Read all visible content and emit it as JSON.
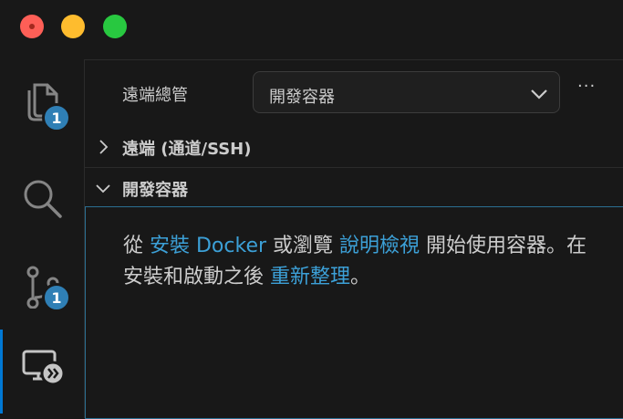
{
  "window": {
    "controls": [
      "close",
      "minimize",
      "maximize"
    ]
  },
  "activity_bar": {
    "items": [
      {
        "name": "explorer",
        "icon": "files-icon",
        "badge": "1"
      },
      {
        "name": "search",
        "icon": "search-icon",
        "badge": ""
      },
      {
        "name": "source-control",
        "icon": "source-control-icon",
        "badge": "1"
      },
      {
        "name": "remote-explorer",
        "icon": "remote-explorer-icon",
        "badge": "",
        "active": true
      }
    ]
  },
  "sidebar": {
    "title": "遠端總管",
    "select_value": "開發容器",
    "more_label": "···",
    "sections": [
      {
        "title": "遠端 (通道/SSH)",
        "expanded": false
      },
      {
        "title": "開發容器",
        "expanded": true
      }
    ],
    "message": {
      "part1": "從 ",
      "link1": "安裝 Docker",
      "part2": " 或瀏覽 ",
      "link2": "說明檢視",
      "part3": " 開始使用容器。在安裝和啟動之後 ",
      "link3": "重新整理",
      "part4": "。"
    }
  },
  "colors": {
    "link": "#3ca0d7",
    "badge": "#2f7fb5",
    "focus_border": "#2b6f92"
  }
}
